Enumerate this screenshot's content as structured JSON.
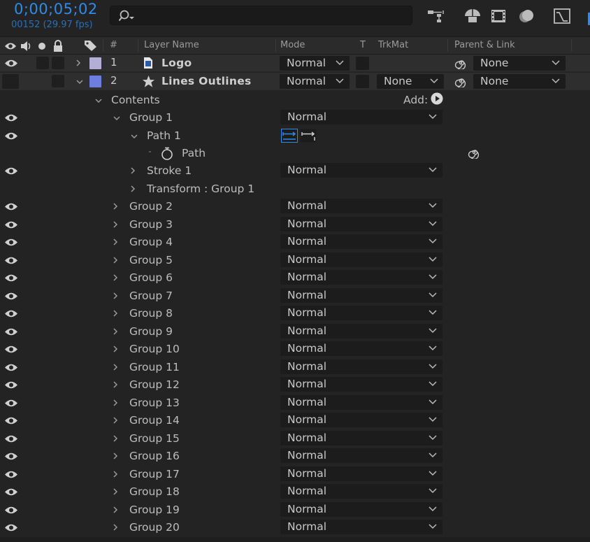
{
  "timecode": "0;00;05;02",
  "frame_info": "00152 (29.97 fps)",
  "columns": {
    "num": "#",
    "layer_name": "Layer Name",
    "mode": "Mode",
    "t": "T",
    "trkmat": "TrkMat",
    "parent": "Parent & Link"
  },
  "layers": [
    {
      "num": "1",
      "name": "Logo",
      "mode": "Normal",
      "trkmat": "",
      "parent": "None",
      "label_color": "#b3aed6"
    },
    {
      "num": "2",
      "name": "Lines Outlines",
      "mode": "Normal",
      "trkmat": "None",
      "parent": "None",
      "label_color": "#6c7fe0"
    }
  ],
  "contents_label": "Contents",
  "add_label": "Add:",
  "group1": {
    "name": "Group 1",
    "mode": "Normal"
  },
  "path1": "Path 1",
  "path": "Path",
  "stroke1": {
    "name": "Stroke 1",
    "mode": "Normal"
  },
  "transform": "Transform : Group 1",
  "groups": [
    {
      "name": "Group 2",
      "mode": "Normal"
    },
    {
      "name": "Group 3",
      "mode": "Normal"
    },
    {
      "name": "Group 4",
      "mode": "Normal"
    },
    {
      "name": "Group 5",
      "mode": "Normal"
    },
    {
      "name": "Group 6",
      "mode": "Normal"
    },
    {
      "name": "Group 7",
      "mode": "Normal"
    },
    {
      "name": "Group 8",
      "mode": "Normal"
    },
    {
      "name": "Group 9",
      "mode": "Normal"
    },
    {
      "name": "Group 10",
      "mode": "Normal"
    },
    {
      "name": "Group 11",
      "mode": "Normal"
    },
    {
      "name": "Group 12",
      "mode": "Normal"
    },
    {
      "name": "Group 13",
      "mode": "Normal"
    },
    {
      "name": "Group 14",
      "mode": "Normal"
    },
    {
      "name": "Group 15",
      "mode": "Normal"
    },
    {
      "name": "Group 16",
      "mode": "Normal"
    },
    {
      "name": "Group 17",
      "mode": "Normal"
    },
    {
      "name": "Group 18",
      "mode": "Normal"
    },
    {
      "name": "Group 19",
      "mode": "Normal"
    },
    {
      "name": "Group 20",
      "mode": "Normal"
    }
  ],
  "colors": {
    "accent": "#2d8ceb",
    "background": "#232323"
  }
}
